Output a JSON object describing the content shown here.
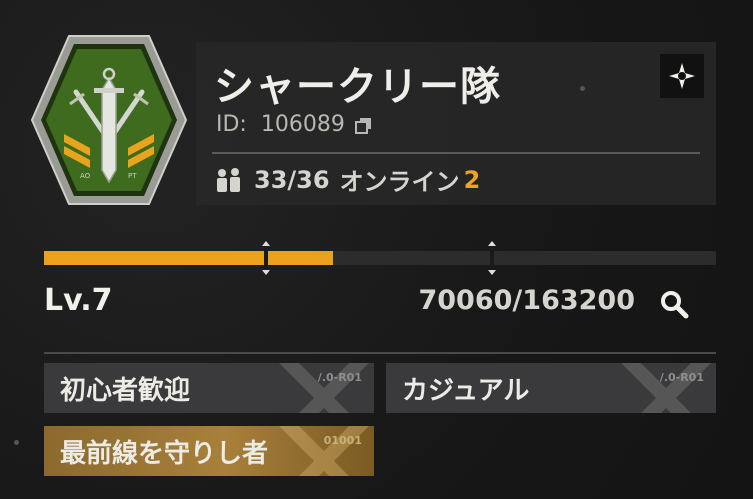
{
  "squad": {
    "name": "シャークリー隊",
    "id_label": "ID:",
    "id_value": "106089",
    "members": "33/36",
    "online_label": "オンライン",
    "online_count": "2",
    "emblem_text_left": "AO",
    "emblem_text_right": "PT"
  },
  "progress": {
    "level": "Lv.7",
    "xp": "70060/163200",
    "fill_fraction": 0.43
  },
  "tags": [
    {
      "label": "初心者歓迎",
      "code": "/.0-R01"
    },
    {
      "label": "カジュアル",
      "code": "/.0-R01"
    },
    {
      "label": "最前線を守りし者",
      "code": "01001"
    }
  ],
  "colors": {
    "accent": "#EDA01C",
    "emblem_green": "#3F6B1E",
    "panel": "#282828"
  },
  "icons": {
    "settings": "settings-compass-icon",
    "copy": "copy-icon",
    "members": "members-icon",
    "search": "search-icon"
  }
}
